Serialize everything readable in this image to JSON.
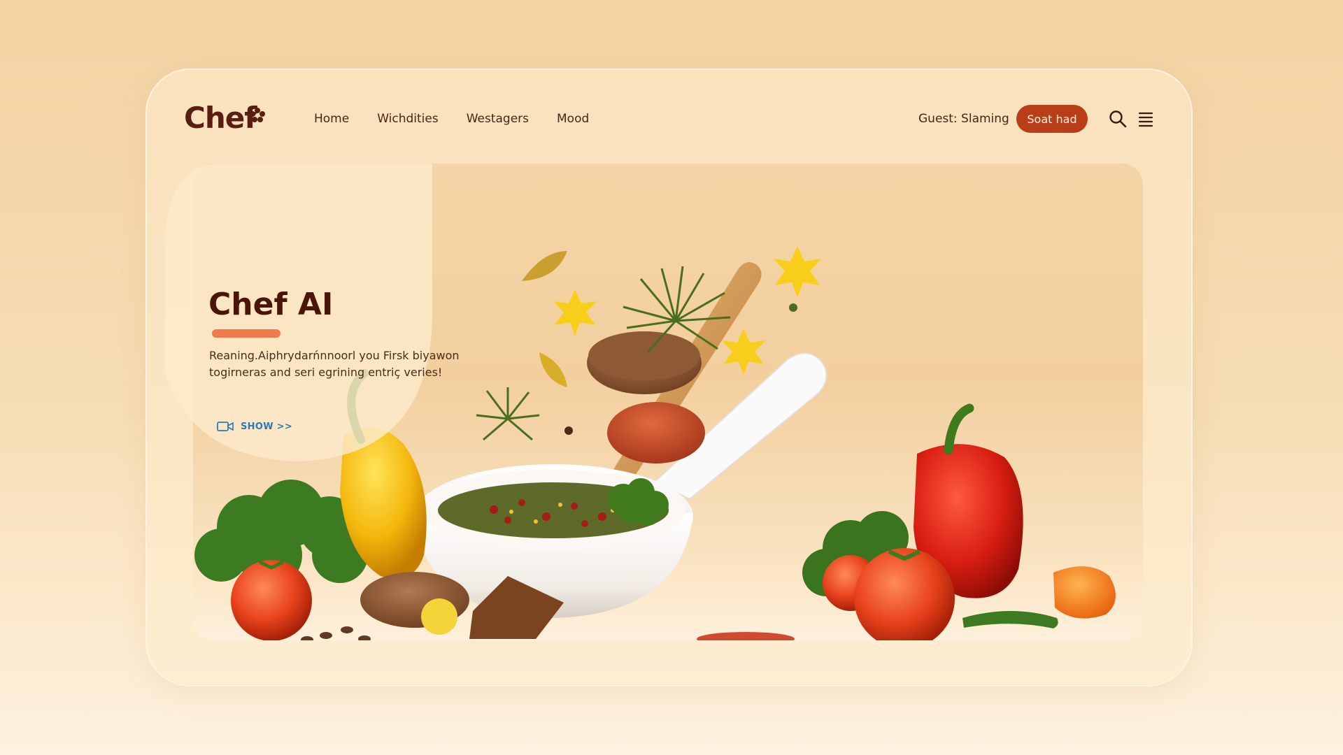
{
  "app": {
    "logo_text": "Chef"
  },
  "nav": {
    "items": [
      {
        "label": "Home"
      },
      {
        "label": "Wichdities"
      },
      {
        "label": "Westagers"
      },
      {
        "label": "Mood"
      }
    ]
  },
  "user": {
    "guest_label": "Guest: Slaming"
  },
  "header": {
    "cta_label": "Soat had"
  },
  "hero": {
    "title": "Chef AI",
    "description_lines": [
      "Reaning.Aiphrydarńnnoorl you Firsk biyawon",
      "togirneras and seri egrining entriç veries!"
    ],
    "show_label": "SHOW >>"
  },
  "colors": {
    "brand_dark": "#5a1d12",
    "cta_background": "#b93e18",
    "title_underline": "#ef7a4c",
    "link_blue": "#2e78b8"
  },
  "icons": {
    "logo_mark": "flower-icon",
    "search": "search-icon",
    "menu": "hamburger-menu-icon",
    "show": "video-camera-icon"
  }
}
